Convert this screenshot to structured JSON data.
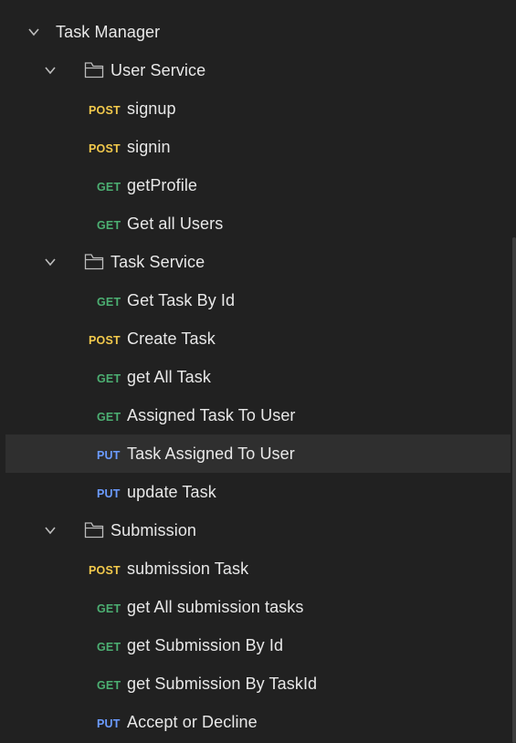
{
  "colors": {
    "background": "#212121",
    "selected_row": "#2f2f2f",
    "text": "#e8e8e8",
    "post": "#f2c94c",
    "get": "#4caf72",
    "put": "#6b9bff"
  },
  "collection": {
    "name": "Task Manager",
    "expanded": true,
    "folders": [
      {
        "name": "User Service",
        "expanded": true,
        "requests": [
          {
            "method": "POST",
            "name": "signup"
          },
          {
            "method": "POST",
            "name": "signin"
          },
          {
            "method": "GET",
            "name": "getProfile"
          },
          {
            "method": "GET",
            "name": "Get all Users"
          }
        ]
      },
      {
        "name": "Task Service",
        "expanded": true,
        "requests": [
          {
            "method": "GET",
            "name": "Get Task By Id"
          },
          {
            "method": "POST",
            "name": "Create Task"
          },
          {
            "method": "GET",
            "name": "get All Task"
          },
          {
            "method": "GET",
            "name": "Assigned Task To User"
          },
          {
            "method": "PUT",
            "name": "Task Assigned To User",
            "selected": true
          },
          {
            "method": "PUT",
            "name": "update Task"
          }
        ]
      },
      {
        "name": "Submission",
        "expanded": true,
        "requests": [
          {
            "method": "POST",
            "name": "submission Task"
          },
          {
            "method": "GET",
            "name": "get All submission tasks"
          },
          {
            "method": "GET",
            "name": "get Submission By Id"
          },
          {
            "method": "GET",
            "name": "get Submission By TaskId"
          },
          {
            "method": "PUT",
            "name": "Accept or Decline"
          }
        ]
      }
    ]
  },
  "icons": {
    "chevron": "chevron-down-icon",
    "folder": "folder-icon"
  }
}
